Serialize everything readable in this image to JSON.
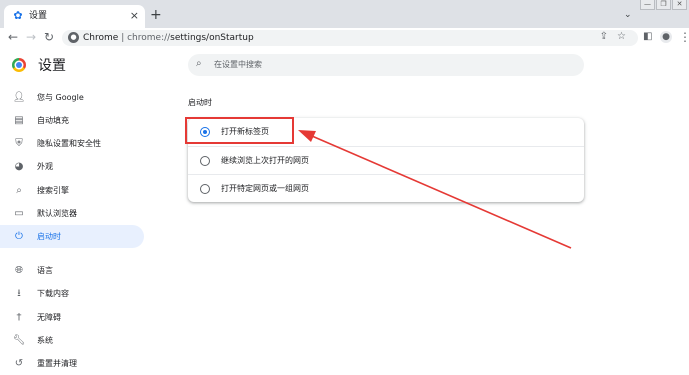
{
  "tab": {
    "title": "设置",
    "close": "×",
    "new_tab": "+",
    "tab_search": "⌄"
  },
  "window": {
    "minimize": "—",
    "restore": "❐",
    "close": "✕"
  },
  "toolbar": {
    "url_host": "Chrome",
    "url_sep": "|",
    "url_scheme": "chrome://",
    "url_path": "settings/onStartup"
  },
  "settings": {
    "title": "设置"
  },
  "search": {
    "placeholder": "在设置中搜索"
  },
  "sidebar": {
    "items": [
      {
        "label": "您与 Google",
        "icon": "person-icon"
      },
      {
        "label": "自动填充",
        "icon": "clipboard-icon"
      },
      {
        "label": "隐私设置和安全性",
        "icon": "shield-icon"
      },
      {
        "label": "外观",
        "icon": "palette-icon"
      },
      {
        "label": "搜索引擎",
        "icon": "search-icon"
      },
      {
        "label": "默认浏览器",
        "icon": "browser-icon"
      },
      {
        "label": "启动时",
        "icon": "power-icon",
        "active": true
      },
      {
        "label": "语言",
        "icon": "globe-icon"
      },
      {
        "label": "下载内容",
        "icon": "download-icon"
      },
      {
        "label": "无障碍",
        "icon": "accessibility-icon"
      },
      {
        "label": "系统",
        "icon": "wrench-icon"
      },
      {
        "label": "重置并清理",
        "icon": "reset-icon"
      }
    ]
  },
  "startup": {
    "section_title": "启动时",
    "options": [
      {
        "label": "打开新标签页",
        "checked": true
      },
      {
        "label": "继续浏览上次打开的网页",
        "checked": false
      },
      {
        "label": "打开特定网页或一组网页",
        "checked": false
      }
    ]
  },
  "annotation": {
    "color": "#e53935"
  },
  "colors": {
    "accent": "#1a73e8",
    "active_bg": "#e8f0fe",
    "tabstrip": "#dee1e6"
  }
}
